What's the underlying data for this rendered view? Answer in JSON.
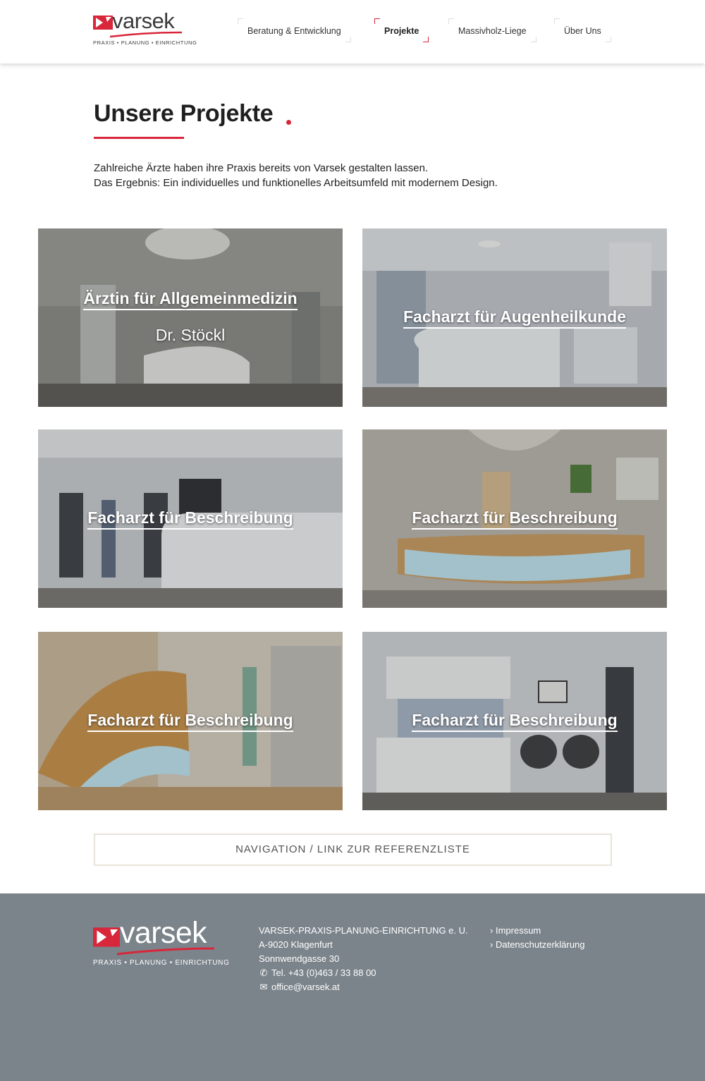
{
  "brand": {
    "name": "varsek",
    "tagline": "PRAXIS • PLANUNG • EINRICHTUNG",
    "accent": "#d8263a"
  },
  "nav": {
    "items": [
      {
        "label": "Beratung & Entwicklung",
        "active": false
      },
      {
        "label": "Projekte",
        "active": true
      },
      {
        "label": "Massivholz-Liege",
        "active": false
      },
      {
        "label": "Über Uns",
        "active": false
      }
    ]
  },
  "page": {
    "title": "Unsere Projekte",
    "intro_line1": "Zahlreiche Ärzte haben ihre Praxis bereits von Varsek gestalten lassen.",
    "intro_line2": "Das Ergebnis: Ein individuelles und funktionelles Arbeitsumfeld mit modernem Design."
  },
  "projects": [
    {
      "title": "Ärztin für Allgemeinmedizin",
      "subtitle": "Dr. Stöckl"
    },
    {
      "title": "Facharzt für Augenheilkunde"
    },
    {
      "title": "Facharzt für Beschreibung"
    },
    {
      "title": "Facharzt für Beschreibung"
    },
    {
      "title": "Facharzt für Beschreibung"
    },
    {
      "title": "Facharzt für Beschreibung"
    }
  ],
  "reference_button": "NAVIGATION / LINK ZUR REFERENZLISTE",
  "footer": {
    "company": "VARSEK-PRAXIS-PLANUNG-EINRICHTUNG e. U.",
    "city": "A-9020 Klagenfurt",
    "street": "Sonnwendgasse 30",
    "phone": "Tel. +43 (0)463 / 33 88 00",
    "email": "office@varsek.at",
    "links": [
      "Impressum",
      "Datenschutzerklärung"
    ],
    "background": "#7b848b"
  }
}
